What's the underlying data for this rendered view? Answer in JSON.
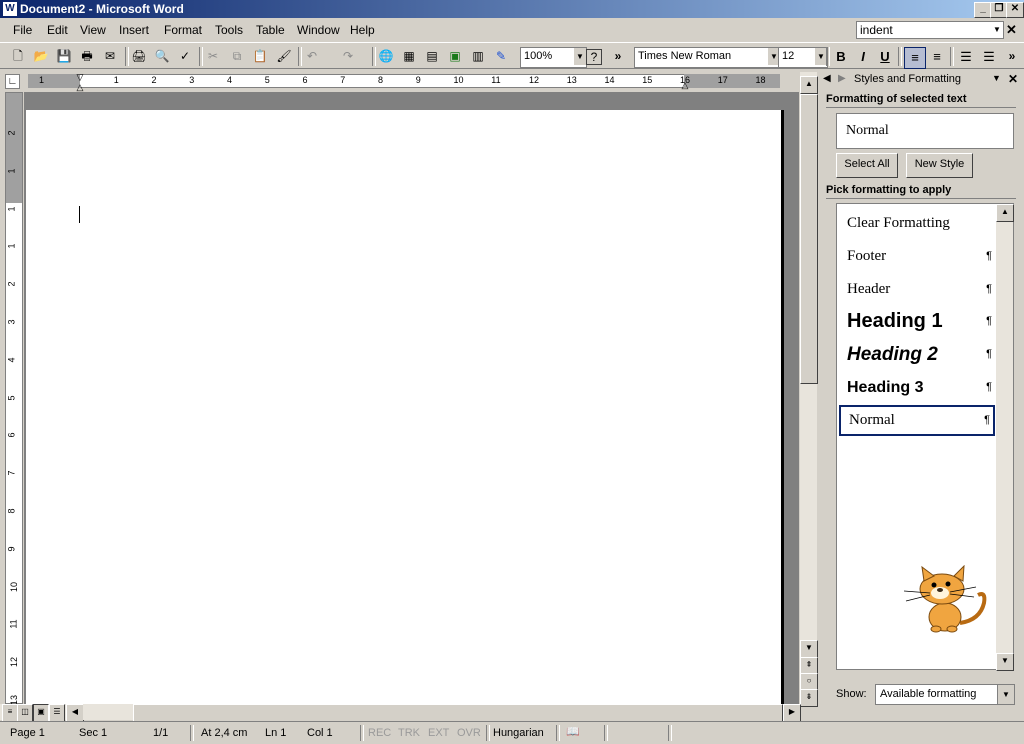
{
  "window": {
    "title": "Document2 - Microsoft Word",
    "app_icon": "W",
    "minimize": "_",
    "maximize": "❐",
    "close": "✕"
  },
  "menu": {
    "items": [
      "File",
      "Edit",
      "View",
      "Insert",
      "Format",
      "Tools",
      "Table",
      "Window",
      "Help"
    ],
    "ask_question": "indent",
    "doc_close": "✕"
  },
  "toolbar": {
    "zoom": "100%",
    "font": "Times New Roman",
    "font_size": "12",
    "bold": "B",
    "italic": "I",
    "underline": "U",
    "more": "»",
    "help": "?",
    "active_alignment": "align-left",
    "icons": [
      "new-icon",
      "open-icon",
      "save-icon",
      "permission-icon",
      "email-icon",
      "print-icon",
      "print-preview-icon",
      "spelling-icon",
      "cut-icon",
      "copy-icon",
      "paste-icon",
      "format-painter-icon",
      "undo-icon",
      "redo-icon",
      "hyperlink-icon",
      "tables-borders-icon",
      "insert-table-icon",
      "insert-excel-icon",
      "columns-icon",
      "drawing-icon",
      "help-icon"
    ],
    "glyphs": {
      "new": "🗋",
      "open": "📂",
      "save": "💾",
      "permission": "🖶",
      "email": "✉",
      "print": "🖨",
      "preview": "🔍",
      "spell": "✓",
      "cut": "✂",
      "copy": "⧉",
      "paste": "📋",
      "painter": "🖌",
      "undo": "↶",
      "redo": "↷",
      "hyperlink": "🌐",
      "tables_borders": "▦",
      "insert_table": "▤",
      "insert_excel": "▣",
      "columns": "▥",
      "drawing": "✎",
      "align_left": "≡",
      "center": "≡",
      "numbering": "☰",
      "bullets": "☰"
    }
  },
  "ruler": {
    "horizontal": [
      "1",
      "1",
      "2",
      "3",
      "4",
      "5",
      "6",
      "7",
      "8",
      "9",
      "10",
      "11",
      "12",
      "13",
      "14",
      "15",
      "16",
      "17",
      "18"
    ],
    "vertical": [
      "2",
      "1",
      "1",
      "1",
      "2",
      "3",
      "4",
      "5",
      "6",
      "7",
      "8",
      "9",
      "10",
      "11",
      "12",
      "13"
    ]
  },
  "status_bar": {
    "page": "Page  1",
    "sec": "Sec  1",
    "pages": "1/1",
    "at": "At  2,4 cm",
    "ln": "Ln  1",
    "col": "Col  1",
    "rec": "REC",
    "trk": "TRK",
    "ext": "EXT",
    "ovr": "OVR",
    "language": "Hungarian",
    "spelling_icon": "📖"
  },
  "task_pane": {
    "title": "Styles and Formatting",
    "back": "◀",
    "forward": "▶",
    "menu_arrow": "▼",
    "close": "✕",
    "selected_section_label": "Formatting of selected text",
    "selected_style": "Normal",
    "select_all": "Select All",
    "new_style": "New Style",
    "pick_label": "Pick formatting to apply",
    "pilcrow": "¶",
    "styles": [
      "Clear Formatting",
      "Footer",
      "Header",
      "Heading 1",
      "Heading 2",
      "Heading 3",
      "Normal"
    ],
    "selected_index": 6,
    "show_label": "Show:",
    "show_value": "Available formatting",
    "assistant": "office-assistant-cat"
  }
}
